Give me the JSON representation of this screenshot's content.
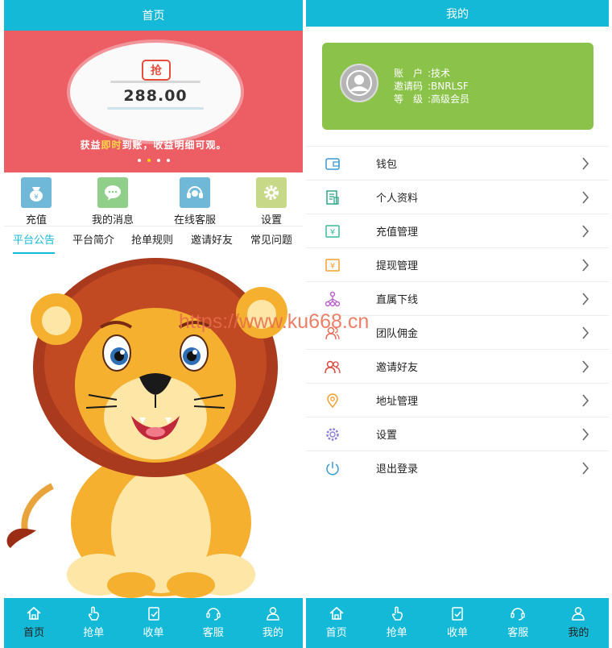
{
  "left": {
    "title": "首页",
    "banner": {
      "badge": "抢",
      "amount": "288.00",
      "slogan_a": "获益",
      "slogan_hl": "即时",
      "slogan_b": "到账，收益明细可观。",
      "dots": 4,
      "active_dot": 1
    },
    "quick_menu": [
      {
        "label": "充值",
        "icon": "wallet-yen-icon",
        "color": "#6fb8d8"
      },
      {
        "label": "我的消息",
        "icon": "chat-icon",
        "color": "#8fcf8a"
      },
      {
        "label": "在线客服",
        "icon": "headset-icon",
        "color": "#6fb8d8"
      },
      {
        "label": "设置",
        "icon": "gear-icon",
        "color": "#c8d889"
      }
    ],
    "tabs": [
      "平台公告",
      "平台简介",
      "抢单规则",
      "邀请好友",
      "常见问题"
    ],
    "active_tab": 0
  },
  "right": {
    "title": "我的",
    "profile": {
      "account_label": "账　户",
      "account_value": "技术",
      "invite_label": "邀请码",
      "invite_value": "BNRLSF",
      "level_label": "等　级",
      "level_value": "高级会员"
    },
    "menu": [
      {
        "label": "钱包",
        "icon": "wallet-icon"
      },
      {
        "label": "个人资料",
        "icon": "profile-doc-icon"
      },
      {
        "label": "充值管理",
        "icon": "recharge-icon"
      },
      {
        "label": "提现管理",
        "icon": "withdraw-icon"
      },
      {
        "label": "直属下线",
        "icon": "org-tree-icon"
      },
      {
        "label": "团队佣金",
        "icon": "team-icon"
      },
      {
        "label": "邀请好友",
        "icon": "invite-users-icon"
      },
      {
        "label": "地址管理",
        "icon": "location-pin-icon"
      },
      {
        "label": "设置",
        "icon": "settings-icon"
      },
      {
        "label": "退出登录",
        "icon": "power-icon"
      }
    ]
  },
  "bottom_nav": [
    {
      "label": "首页",
      "icon": "home-icon"
    },
    {
      "label": "抢单",
      "icon": "hand-tap-icon"
    },
    {
      "label": "收单",
      "icon": "clipboard-check-icon"
    },
    {
      "label": "客服",
      "icon": "headset-icon"
    },
    {
      "label": "我的",
      "icon": "user-icon"
    }
  ],
  "left_active_nav": 0,
  "right_active_nav": 4,
  "watermark": "https://www.ku668.cn",
  "colors": {
    "accent": "#13b9d6",
    "banner_red": "#ec5d64",
    "card_green": "#8bc34a"
  }
}
